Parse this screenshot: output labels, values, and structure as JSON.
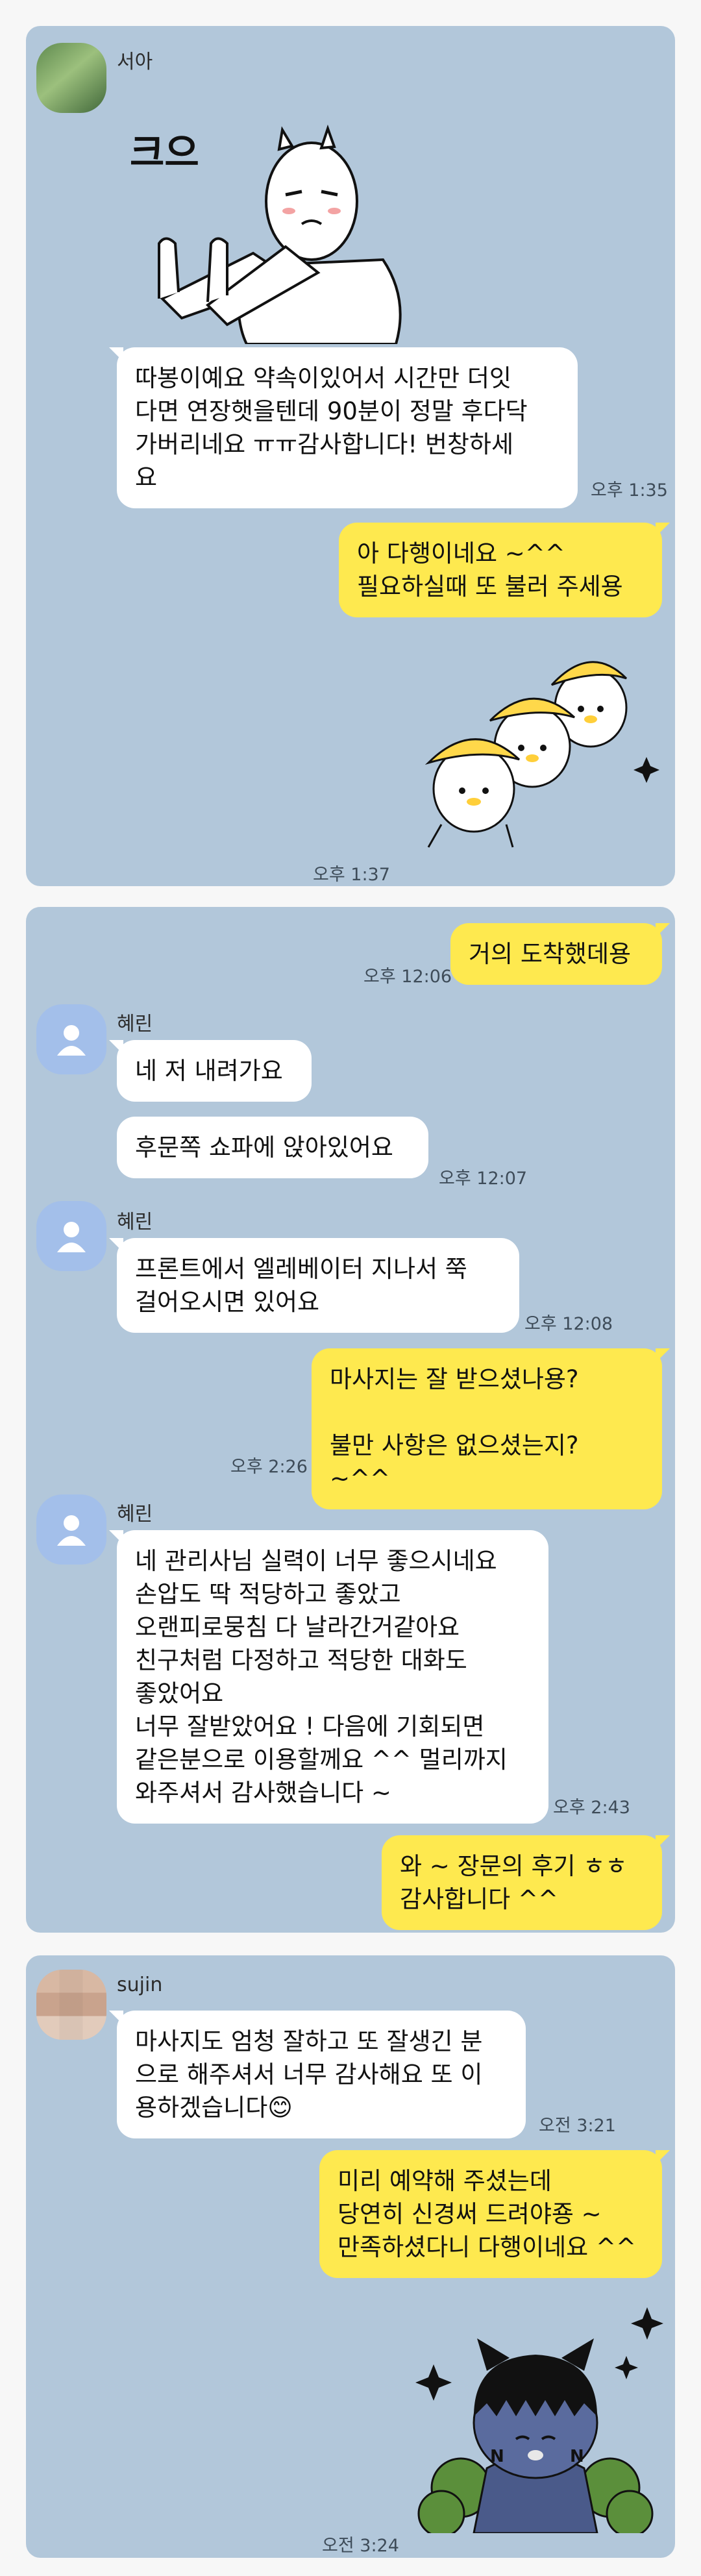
{
  "chat1": {
    "sender": "서아",
    "sticker_text": "크으",
    "msg_in": "따봉이예요 약속이있어서 시간만 더잇\n다면 연장햇을텐데 90분이 정말 후다닥\n가버리네요 ㅠㅠ감사합니다! 번창하세\n요",
    "time_in": "오후 1:35",
    "msg_out": "아 다행이네요 ~^^\n필요하실때 또 불러 주세용",
    "time_sticker": "오후 1:37"
  },
  "chat2": {
    "out1": "거의 도착했데용",
    "out1_time": "오후 12:06",
    "sender": "혜린",
    "in1": "네 저 내려가요",
    "in2": "후문쪽 쇼파에 앉아있어요",
    "in2_time": "오후 12:07",
    "in3": "프론트에서 엘레베이터 지나서 쭉\n걸어오시면 있어요",
    "in3_time": "오후 12:08",
    "out2": "마사지는 잘 받으셨나용?\n\n불만 사항은 없으셨는지? ~^^",
    "out2_time": "오후 2:26",
    "in4": "네 관리사님 실력이 너무 좋으시네요\n손압도 딱 적당하고 좋았고\n오랜피로뭉침 다 날라간거같아요\n친구처럼 다정하고 적당한 대화도\n좋았어요\n너무 잘받았어요 ! 다음에 기회되면\n같은분으로 이용할께요 ^^ 멀리까지\n와주셔서 감사했습니다 ~",
    "in4_time": "오후 2:43",
    "out3": "와 ~ 장문의 후기 ㅎㅎ\n감사합니다 ^^"
  },
  "chat3": {
    "sender": "sujin",
    "in1": "마사지도 엄청 잘하고 또 잘생긴 분\n으로 해주셔서 너무 감사해요 또 이\n용하겠습니다😊",
    "in1_time": "오전 3:21",
    "out1": "미리 예약해 주셨는데\n당연히 신경써 드려야죵 ~\n만족하셨다니 다행이네요 ^^",
    "sticker_time": "오전 3:24"
  },
  "icons": {
    "default_avatar": "person-icon",
    "stickers": [
      "thumbs-up-character-sticker",
      "banana-hat-characters-sticker",
      "ryan-cat-sticker"
    ]
  },
  "colors": {
    "chat_background": "#b2c7da",
    "outgoing_bubble": "#fee94f",
    "incoming_bubble": "#ffffff",
    "default_avatar": "#a3bfea"
  }
}
